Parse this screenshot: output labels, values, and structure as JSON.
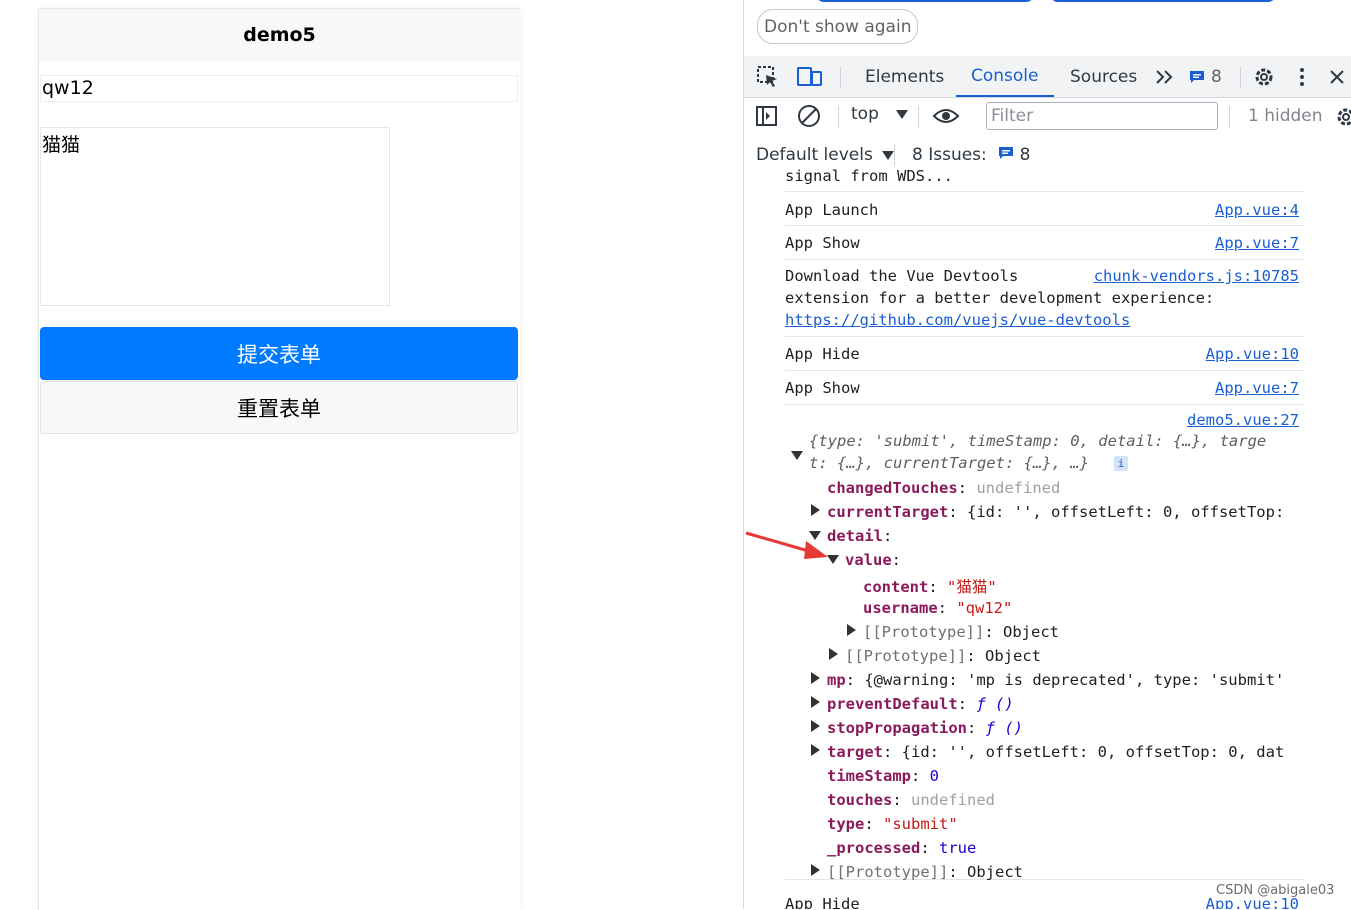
{
  "phone": {
    "nav_title": "demo5",
    "username_value": "qw12",
    "content_value": "猫猫",
    "submit_label": "提交表单",
    "reset_label": "重置表单"
  },
  "devtools": {
    "infobar": {
      "dont_show_label": "Don't show again"
    },
    "tabs": {
      "elements": "Elements",
      "console": "Console",
      "sources": "Sources",
      "more": "»",
      "issues_count": "8"
    },
    "toolbar": {
      "context": "top",
      "filter_placeholder": "Filter",
      "hidden": "1 hidden"
    },
    "levels": {
      "default_levels": "Default levels",
      "issues_label": "8 Issues:",
      "issues_count": "8"
    },
    "console": {
      "cut_line": "signal from WDS...",
      "messages": [
        {
          "text": "App Launch",
          "source": "App.vue:4"
        },
        {
          "text": "App Show",
          "source": "App.vue:7"
        },
        {
          "text_1": "Download the Vue Devtools",
          "text_2": "extension for a better development experience:",
          "link": "https://github.com/vuejs/vue-devtools",
          "source": "chunk-vendors.js:10785"
        },
        {
          "text": "App Hide",
          "source": "App.vue:10"
        },
        {
          "text": "App Show",
          "source": "App.vue:7"
        }
      ],
      "object_source": "demo5.vue:27",
      "object_summary_1": "{type: 'submit', timeStamp: 0, detail: {…}, targe",
      "object_summary_2": "t: {…}, currentTarget: {…}, …}",
      "info_badge": "i",
      "props": {
        "changedTouches_key": "changedTouches",
        "changedTouches_val": "undefined",
        "currentTarget_key": "currentTarget",
        "currentTarget_val": "{id: '', offsetLeft: 0, offsetTop:",
        "detail_key": "detail",
        "value_key": "value",
        "content_key": "content",
        "content_val": "\"猫猫\"",
        "username_key": "username",
        "username_val": "\"qw12\"",
        "proto_inner": "[[Prototype]]",
        "proto_inner_val": "Object",
        "proto_detail": "[[Prototype]]",
        "proto_detail_val": "Object",
        "mp_key": "mp",
        "mp_val": "{@warning: 'mp is deprecated', type: 'submit'",
        "preventDefault_key": "preventDefault",
        "preventDefault_val": "ƒ ()",
        "stopPropagation_key": "stopPropagation",
        "stopPropagation_val": "ƒ ()",
        "target_key": "target",
        "target_val": "{id: '', offsetLeft: 0, offsetTop: 0, dat",
        "timeStamp_key": "timeStamp",
        "timeStamp_val": "0",
        "touches_key": "touches",
        "touches_val": "undefined",
        "type_key": "type",
        "type_val": "\"submit\"",
        "processed_key": "_processed",
        "processed_val": "true",
        "proto_root": "[[Prototype]]",
        "proto_root_val": "Object"
      },
      "last_msg": {
        "text": "App Hide",
        "source": "App.vue:10"
      }
    }
  },
  "watermark": "CSDN @abigale03",
  "colors": {
    "accent": "#007aff",
    "devtools_blue": "#1a5fd1",
    "arrow": "#e53935"
  }
}
